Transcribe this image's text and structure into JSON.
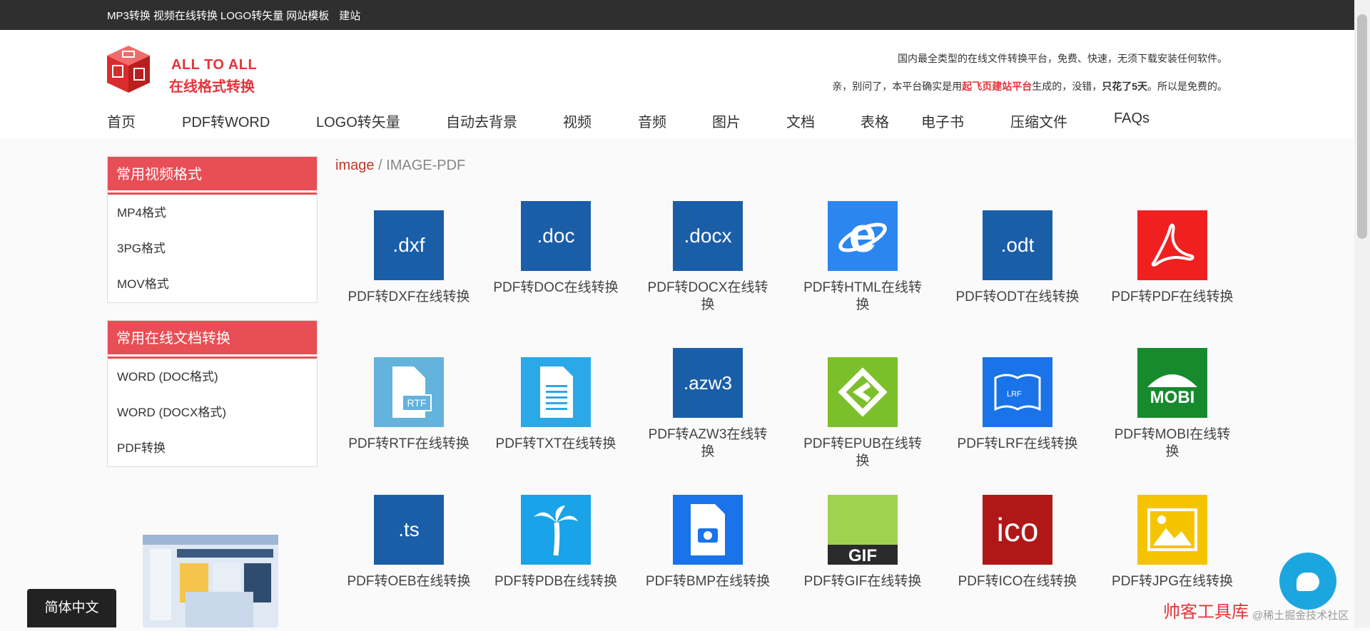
{
  "topbar": {
    "links": [
      "MP3转换",
      "视频在线转换",
      "LOGO转矢量",
      "网站模板",
      "建站"
    ]
  },
  "header": {
    "logo_line1": "ALL TO ALL",
    "logo_line2": "在线格式转换",
    "slogan1": "国内最全类型的在线文件转换平台，免费、快速，无须下载安装任何软件。",
    "slogan2_prefix": "亲，别问了，本平台确实是用",
    "slogan2_highlight": "起飞页建站平台",
    "slogan2_mid": "生成的，没错，",
    "slogan2_bold": "只花了5天",
    "slogan2_suffix": "。所以是免费的。"
  },
  "nav": [
    "首页",
    "PDF转WORD",
    "LOGO转矢量",
    "自动去背景",
    "视频",
    "音频",
    "图片",
    "文档",
    "表格",
    "电子书",
    "压缩文件",
    "FAQs"
  ],
  "sidebar": {
    "box1": {
      "title": "常用视频格式",
      "items": [
        "MP4格式",
        "3PG格式",
        "MOV格式"
      ]
    },
    "box2": {
      "title": "常用在线文档转换",
      "items": [
        "WORD (DOC格式)",
        "WORD (DOCX格式)",
        "PDF转换"
      ]
    }
  },
  "language_button": "简体中文",
  "breadcrumb": {
    "link": "image",
    "separator": " / ",
    "current": "IMAGE-PDF"
  },
  "converters": [
    {
      "label": "PDF转DXF在线转换",
      "icon": "dxf-icon",
      "icon_text": ".dxf",
      "color": "#1b5ea8"
    },
    {
      "label": "PDF转DOC在线转换",
      "icon": "doc-icon",
      "icon_text": ".doc",
      "color": "#1b5ea8"
    },
    {
      "label": "PDF转DOCX在线转换",
      "icon": "docx-icon",
      "icon_text": ".docx",
      "color": "#1b5ea8"
    },
    {
      "label": "PDF转HTML在线转换",
      "icon": "ie-icon",
      "icon_text": "",
      "color": "#2b86f0"
    },
    {
      "label": "PDF转ODT在线转换",
      "icon": "odt-icon",
      "icon_text": ".odt",
      "color": "#1b5ea8"
    },
    {
      "label": "PDF转PDF在线转换",
      "icon": "acrobat-icon",
      "icon_text": "",
      "color": "#f02020"
    },
    {
      "label": "PDF转RTF在线转换",
      "icon": "rtf-icon",
      "icon_text": "RTF",
      "color": "#63b3dd"
    },
    {
      "label": "PDF转TXT在线转换",
      "icon": "txt-icon",
      "icon_text": "",
      "color": "#2aa8e8"
    },
    {
      "label": "PDF转AZW3在线转换",
      "icon": "azw3-icon",
      "icon_text": ".azw3",
      "color": "#1b5ea8"
    },
    {
      "label": "PDF转EPUB在线转换",
      "icon": "epub-icon",
      "icon_text": "",
      "color": "#7bbf2a"
    },
    {
      "label": "PDF转LRF在线转换",
      "icon": "lrf-icon",
      "icon_text": "LRF",
      "color": "#1a73e8"
    },
    {
      "label": "PDF转MOBI在线转换",
      "icon": "mobi-icon",
      "icon_text": "MOBI",
      "color": "#178a2e"
    },
    {
      "label": "PDF转OEB在线转换",
      "icon": "oeb-icon",
      "icon_text": ".ts",
      "color": "#1b5ea8"
    },
    {
      "label": "PDF转PDB在线转换",
      "icon": "palm-icon",
      "icon_text": "",
      "color": "#1aa3e8"
    },
    {
      "label": "PDF转BMP在线转换",
      "icon": "bmp-icon",
      "icon_text": "",
      "color": "#1a73e8"
    },
    {
      "label": "PDF转GIF在线转换",
      "icon": "gif-icon",
      "icon_text": "GIF",
      "color": "#8cc63f"
    },
    {
      "label": "PDF转ICO在线转换",
      "icon": "ico-icon",
      "icon_text": "ico",
      "color": "#b01818"
    },
    {
      "label": "PDF转JPG在线转换",
      "icon": "jpg-icon",
      "icon_text": "",
      "color": "#f5c400"
    }
  ],
  "watermark": {
    "red": "帅客工具库",
    "gray": "@稀土掘金技术社区"
  }
}
